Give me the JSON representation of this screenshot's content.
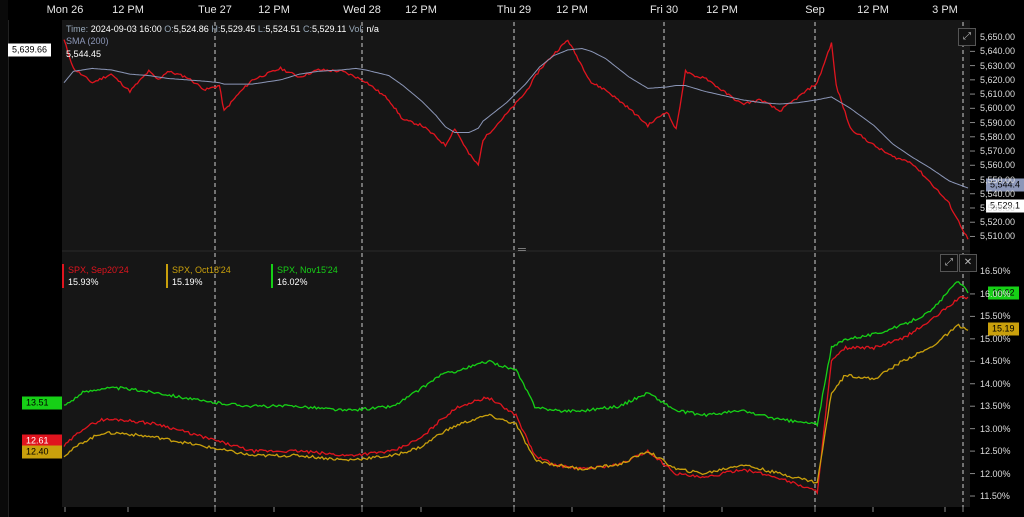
{
  "x_axis_labels": [
    "Mon 26",
    "12 PM",
    "Tue 27",
    "12 PM",
    "Wed 28",
    "12 PM",
    "Thu 29",
    "12 PM",
    "Fri 30",
    "12 PM",
    "Sep",
    "12 PM",
    "3 PM"
  ],
  "info_line": {
    "time_label": "Time:",
    "time_value": "2024-09-03 16:00",
    "open_label": "O:",
    "open_value": "5,524.86",
    "high_label": "H:",
    "high_value": "5,529.45",
    "low_label": "L:",
    "low_value": "5,524.51",
    "close_label": "C:",
    "close_value": "5,529.11",
    "vol_label": "Vol:",
    "vol_value": "n/a"
  },
  "sma_label": "SMA (200)",
  "sma_value": "5,544.45",
  "upper_tags": {
    "left_marker": "5,639.66",
    "sma_right": "5,544.4",
    "last_right": "5,529.1"
  },
  "legend": [
    {
      "name": "SPX, Sep20'24",
      "value": "15.93%",
      "color": "#e0141e"
    },
    {
      "name": "SPX, Oct18'24",
      "value": "15.19%",
      "color": "#c9a00c"
    },
    {
      "name": "SPX, Nov15'24",
      "value": "16.02%",
      "color": "#16d016"
    }
  ],
  "lower_tags": {
    "left_green": "13.51",
    "left_red": "12.61",
    "left_gold": "12.40",
    "right_green": "16.02",
    "right_gold": "15.19"
  },
  "colors": {
    "price": "#e0141e",
    "sma": "#8c97b8",
    "iv_sep": "#e0141e",
    "iv_oct": "#c9a00c",
    "iv_nov": "#16d016"
  },
  "chart_data": [
    {
      "type": "line",
      "title": "",
      "ylim": [
        5504,
        5655
      ],
      "y_ticks": [
        "5,650.00",
        "5,640.00",
        "5,630.00",
        "5,620.00",
        "5,610.00",
        "5,600.00",
        "5,590.00",
        "5,580.00",
        "5,570.00",
        "5,560.00",
        "5,550.00",
        "5,540.00",
        "5,530.00",
        "5,520.00",
        "5,510.00"
      ],
      "y_tick_values": [
        5650,
        5640,
        5630,
        5620,
        5610,
        5600,
        5590,
        5580,
        5570,
        5560,
        5550,
        5540,
        5530,
        5520,
        5510
      ],
      "x": [
        0,
        10,
        30,
        50,
        70,
        90,
        100,
        110,
        130,
        150,
        165,
        170,
        185,
        200,
        230,
        250,
        270,
        295,
        310,
        320,
        345,
        360,
        380,
        395,
        405,
        415,
        430,
        440,
        445,
        470,
        490,
        505,
        520,
        535,
        550,
        560,
        575,
        600,
        620,
        640,
        650,
        660,
        670,
        680,
        700,
        720,
        740,
        760,
        780,
        800,
        815,
        820,
        835,
        860,
        880,
        900,
        920,
        940,
        960
      ],
      "series": [
        {
          "name": "SPX",
          "values": [
            5648,
            5628,
            5618,
            5624,
            5612,
            5626,
            5620,
            5626,
            5622,
            5613,
            5616,
            5598,
            5610,
            5620,
            5628,
            5622,
            5627,
            5626,
            5622,
            5619,
            5606,
            5592,
            5588,
            5580,
            5574,
            5586,
            5568,
            5560,
            5578,
            5596,
            5611,
            5627,
            5638,
            5648,
            5630,
            5618,
            5613,
            5600,
            5588,
            5598,
            5585,
            5626,
            5622,
            5622,
            5612,
            5603,
            5606,
            5598,
            5608,
            5618,
            5646,
            5616,
            5586,
            5574,
            5566,
            5562,
            5548,
            5533,
            5508
          ]
        },
        {
          "name": "SMA (200)",
          "values": [
            5618,
            5626,
            5628,
            5627,
            5624,
            5623,
            5622,
            5621,
            5620,
            5619,
            5618,
            5617,
            5617,
            5617,
            5620,
            5624,
            5626,
            5627,
            5628,
            5627,
            5623,
            5616,
            5605,
            5595,
            5587,
            5583,
            5583,
            5586,
            5591,
            5604,
            5617,
            5629,
            5637,
            5641,
            5642,
            5640,
            5635,
            5622,
            5614,
            5615,
            5616,
            5616,
            5614,
            5612,
            5609,
            5606,
            5604,
            5603,
            5604,
            5606,
            5608,
            5606,
            5600,
            5588,
            5575,
            5566,
            5558,
            5549,
            5544
          ]
        }
      ]
    },
    {
      "type": "line",
      "title": "",
      "ylim": [
        11.3,
        16.8
      ],
      "y_ticks": [
        "16.50%",
        "16.00%",
        "15.50%",
        "15.00%",
        "14.50%",
        "14.00%",
        "13.50%",
        "13.00%",
        "12.50%",
        "12.00%",
        "11.50%"
      ],
      "y_tick_values": [
        16.5,
        16.0,
        15.5,
        15.0,
        14.5,
        14.0,
        13.5,
        13.0,
        12.5,
        12.0,
        11.5
      ],
      "x": [
        0,
        20,
        40,
        60,
        100,
        150,
        200,
        250,
        300,
        350,
        380,
        400,
        420,
        450,
        480,
        500,
        520,
        550,
        590,
        620,
        650,
        680,
        720,
        760,
        800,
        815,
        830,
        860,
        890,
        920,
        950,
        960
      ],
      "series": [
        {
          "name": "SPX, Sep20'24",
          "values": [
            12.61,
            13.0,
            13.2,
            13.2,
            13.1,
            12.8,
            12.5,
            12.5,
            12.4,
            12.5,
            12.8,
            13.2,
            13.5,
            13.7,
            13.3,
            12.4,
            12.2,
            12.1,
            12.2,
            12.5,
            12.0,
            11.9,
            12.1,
            11.9,
            11.6,
            14.5,
            14.8,
            14.8,
            15.0,
            15.4,
            15.9,
            15.93
          ]
        },
        {
          "name": "SPX, Oct18'24",
          "values": [
            12.4,
            12.7,
            12.9,
            12.9,
            12.8,
            12.6,
            12.4,
            12.4,
            12.3,
            12.4,
            12.6,
            12.9,
            13.1,
            13.3,
            13.1,
            12.3,
            12.2,
            12.1,
            12.2,
            12.5,
            12.1,
            12.0,
            12.2,
            12.0,
            11.8,
            13.8,
            14.2,
            14.1,
            14.5,
            14.8,
            15.3,
            15.19
          ]
        },
        {
          "name": "SPX, Nov15'24",
          "values": [
            13.51,
            13.8,
            13.9,
            13.9,
            13.8,
            13.6,
            13.5,
            13.5,
            13.4,
            13.5,
            13.9,
            14.2,
            14.3,
            14.5,
            14.3,
            13.5,
            13.4,
            13.4,
            13.5,
            13.8,
            13.4,
            13.3,
            13.4,
            13.2,
            13.1,
            14.8,
            15.0,
            15.1,
            15.3,
            15.6,
            16.3,
            16.02
          ]
        }
      ]
    }
  ]
}
